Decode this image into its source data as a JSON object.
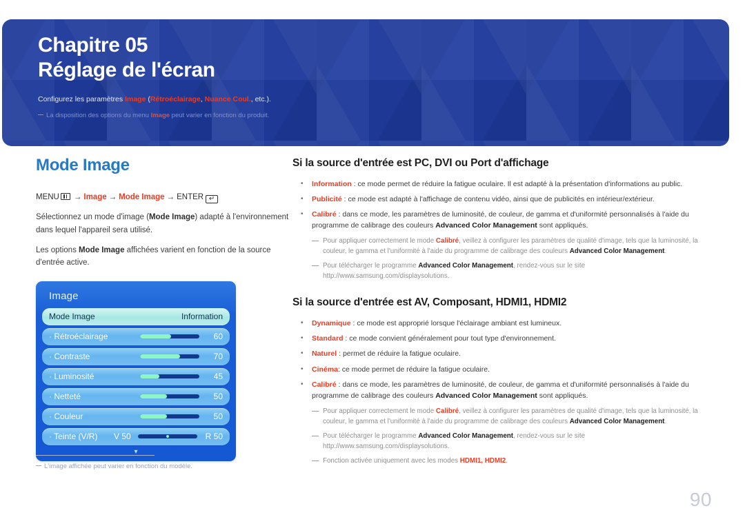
{
  "banner": {
    "chapter_label": "Chapitre 05",
    "chapter_title": "Réglage de l'écran",
    "subtitle_prefix": "Configurez les paramètres ",
    "subtitle_term1": "Image",
    "subtitle_mid": " (",
    "subtitle_term2": "Rétroéclairage",
    "subtitle_sep": ", ",
    "subtitle_term3": "Nuance Coul.",
    "subtitle_suffix": ", etc.).",
    "note_prefix": "La disposition des options du menu ",
    "note_term": "Image",
    "note_suffix": " peut varier en fonction du produit.",
    "bg_color": "#1f3ca0",
    "accent_color": "#eb3b23"
  },
  "left": {
    "section_title": "Mode Image",
    "menu_path": {
      "menu_label": "MENU",
      "menu_icon": "menu-bars-icon",
      "arrow": "→",
      "item1": "Image",
      "item2": "Mode Image",
      "enter_label": "ENTER",
      "enter_icon": "enter-key-icon",
      "enter_glyph": "↵"
    },
    "paragraph1_a": "Sélectionnez un mode d'image (",
    "paragraph1_b": "Mode Image",
    "paragraph1_c": ") adapté à l'environnement dans lequel l'appareil sera utilisé.",
    "paragraph2_a": "Les options ",
    "paragraph2_b": "Mode Image",
    "paragraph2_c": " affichées varient en fonction de la source d'entrée active.",
    "footnote": "L'image affichée peut varier en fonction du modèle."
  },
  "osd": {
    "title": "Image",
    "rows": [
      {
        "label": "Mode Image",
        "value": "Information",
        "type": "selected"
      },
      {
        "label": "· Rétroéclairage",
        "value": "60",
        "type": "slider",
        "fill_pct": 52
      },
      {
        "label": "· Contraste",
        "value": "70",
        "type": "slider",
        "fill_pct": 68
      },
      {
        "label": "· Luminosité",
        "value": "45",
        "type": "slider",
        "fill_pct": 32
      },
      {
        "label": "· Netteté",
        "value": "50",
        "type": "slider",
        "fill_pct": 45
      },
      {
        "label": "· Couleur",
        "value": "50",
        "type": "slider",
        "fill_pct": 45
      },
      {
        "label": "· Teinte (V/R)",
        "vlabel": "V 50",
        "value": "R 50",
        "type": "centered"
      }
    ],
    "scroll_arrow": "▾",
    "panel_color": "#1558d4",
    "row_color": "#66b5ef",
    "selected_row_color": "#a6e8e4",
    "slider_fill_color": "#8df5c8",
    "slider_track_color": "#123a8c"
  },
  "right": {
    "section1": {
      "heading": "Si la source d'entrée est PC, DVI ou Port d'affichage",
      "bullets": [
        {
          "term": "Information",
          "text": " : ce mode permet de réduire la fatigue oculaire. Il est adapté à la présentation d'informations au public."
        },
        {
          "term": "Publicité",
          "text": " : ce mode est adapté à l'affichage de contenu vidéo, ainsi que de publicités en intérieur/extérieur."
        },
        {
          "term": "Calibré",
          "text": " : dans ce mode, les paramètres de luminosité, de couleur, de gamma et d'uniformité personnalisés à l'aide du programme de calibrage des couleurs ",
          "strong": "Advanced Color Management",
          "text2": " sont appliqués."
        }
      ],
      "notes": [
        {
          "a": "Pour appliquer correctement le mode ",
          "term": "Calibré",
          "b": ", veillez à configurer les paramètres de qualité d'image, tels que la luminosité, la couleur, le gamma et l'uniformité à l'aide du programme de calibrage des couleurs ",
          "strong": "Advanced Color Management",
          "c": "."
        },
        {
          "a": "Pour télécharger le programme ",
          "strong": "Advanced Color Management",
          "b": ", rendez-vous sur le site http://www.samsung.com/displaysolutions."
        }
      ]
    },
    "section2": {
      "heading": "Si la source d'entrée est AV, Composant, HDMI1, HDMI2",
      "bullets": [
        {
          "term": "Dynamique",
          "text": " : ce mode est approprié lorsque l'éclairage ambiant est lumineux."
        },
        {
          "term": "Standard",
          "text": " : ce mode convient généralement pour tout type d'environnement."
        },
        {
          "term": "Naturel",
          "text": " : permet de réduire la fatigue oculaire."
        },
        {
          "term": "Cinéma",
          "text": ": ce mode permet de réduire la fatigue oculaire."
        },
        {
          "term": "Calibré",
          "text": " : dans ce mode, les paramètres de luminosité, de couleur, de gamma et d'uniformité personnalisés à l'aide du programme de calibrage des couleurs ",
          "strong": "Advanced Color Management",
          "text2": " sont appliqués."
        }
      ],
      "notes": [
        {
          "a": "Pour appliquer correctement le mode ",
          "term": "Calibré",
          "b": ", veillez à configurer les paramètres de qualité d'image, tels que la luminosité, la couleur, le gamma et l'uniformité à l'aide du programme de calibrage des couleurs ",
          "strong": "Advanced Color Management",
          "c": "."
        },
        {
          "a": "Pour télécharger le programme ",
          "strong": "Advanced Color Management",
          "b": ", rendez-vous sur le site http://www.samsung.com/displaysolutions."
        },
        {
          "a": "Fonction activée uniquement avec les modes ",
          "term": "HDMI1, HDMI2",
          "b": "."
        }
      ]
    }
  },
  "page_number": "90"
}
